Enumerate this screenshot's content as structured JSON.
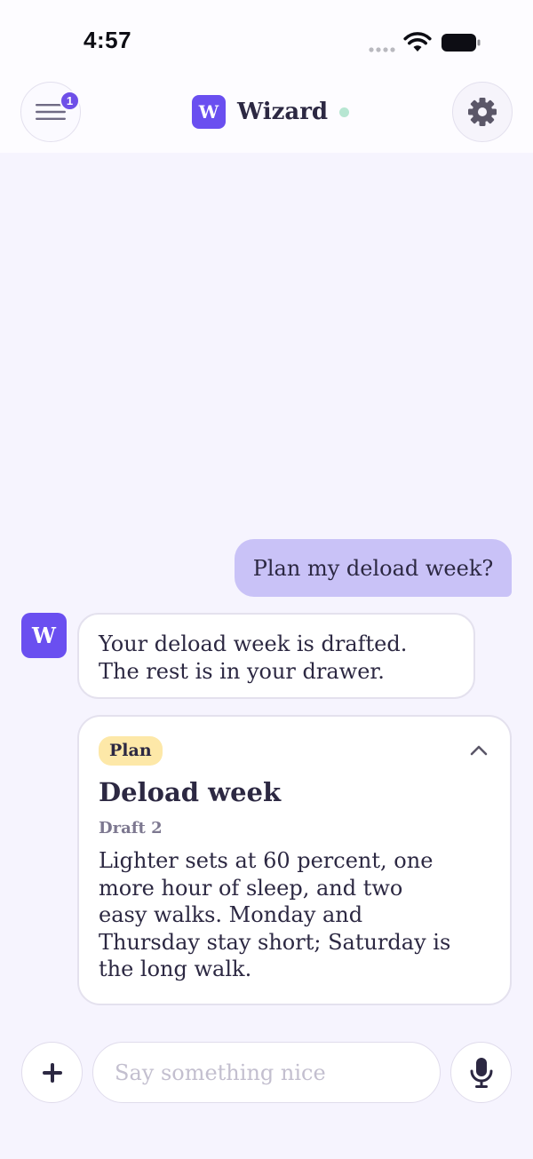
{
  "status_bar": {
    "time": "4:57",
    "icons": [
      "signal-dots-icon",
      "wifi-icon",
      "battery-icon"
    ]
  },
  "header": {
    "menu_badge_count": "1",
    "brand_logo_letter": "W",
    "title": "Wizard",
    "online_status_color": "#b7e6d2",
    "icons": [
      "menu-icon",
      "gear-icon"
    ]
  },
  "chat": {
    "user_message": "Plan my deload week?",
    "assistant_avatar_letter": "W",
    "assistant_message": "Your deload week is drafted. The rest is in your drawer.",
    "plan_card": {
      "tag": "Plan",
      "title": "Deload week",
      "draft": "Draft 2",
      "body": "Lighter sets at 60 percent, one more hour of sleep, and two easy walks. Monday and Thursday stay short; Saturday is the long walk.",
      "expanded": true
    }
  },
  "composer": {
    "placeholder": "Say something nice",
    "value": "",
    "icons": [
      "plus-icon",
      "microphone-icon"
    ]
  },
  "colors": {
    "accent": "#6a4ff0",
    "user_bubble": "#c9c2f7",
    "tag_background": "#fde8a8",
    "background": "#f6f4fe"
  }
}
